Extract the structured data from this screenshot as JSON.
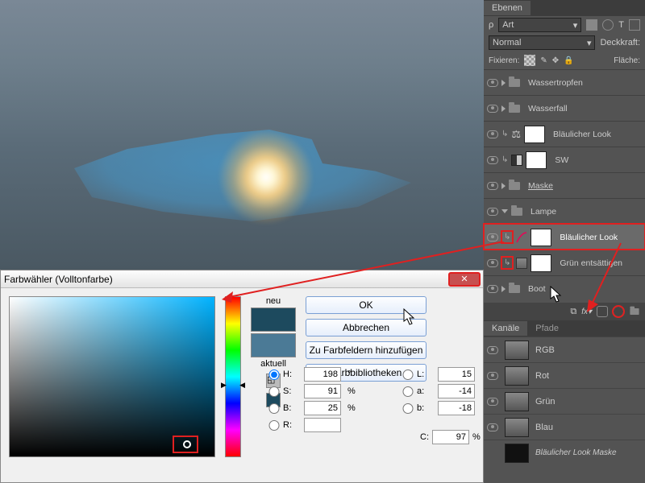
{
  "layersPanel": {
    "tab": "Ebenen",
    "kind": "Art",
    "blend": "Normal",
    "opacityLabel": "Deckkraft:",
    "lockLabel": "Fixieren:",
    "fillLabel": "Fläche:",
    "groups": [
      {
        "name": "Wassertropfen",
        "folder": true
      },
      {
        "name": "Wasserfall",
        "folder": true
      }
    ],
    "adjLayers": [
      {
        "name": "Bläulicher Look",
        "icon": "balance"
      },
      {
        "name": "SW",
        "icon": "bw"
      }
    ],
    "groups2": [
      {
        "name": "Maske",
        "folder": true,
        "underline": true
      },
      {
        "name": "Lampe",
        "folder": true
      }
    ],
    "selected": {
      "name": "Bläulicher Look"
    },
    "below": {
      "name": "Grün entsättigen"
    },
    "bootGroup": {
      "name": "Boot"
    }
  },
  "channelsPanel": {
    "tabs": [
      "Kanäle",
      "Pfade"
    ],
    "channels": [
      "RGB",
      "Rot",
      "Grün",
      "Blau"
    ],
    "mask": "Bläulicher Look Maske"
  },
  "colorPicker": {
    "title": "Farbwähler (Volltonfarbe)",
    "newLabel": "neu",
    "currentLabel": "aktuell",
    "newColor": "#1d4a5e",
    "currentColor": "#4b7a96",
    "buttons": {
      "ok": "OK",
      "cancel": "Abbrechen",
      "add": "Zu Farbfeldern hinzufügen",
      "lib": "Farbbibliotheken"
    },
    "fields": {
      "H": {
        "label": "H:",
        "value": "198",
        "unit": "°"
      },
      "S": {
        "label": "S:",
        "value": "91",
        "unit": "%"
      },
      "Br": {
        "label": "B:",
        "value": "25",
        "unit": "%"
      },
      "R": {
        "label": "R:",
        "value": ""
      },
      "L": {
        "label": "L:",
        "value": "15"
      },
      "a": {
        "label": "a:",
        "value": "-14"
      },
      "b": {
        "label": "b:",
        "value": "-18"
      },
      "C": {
        "label": "C:",
        "value": "97",
        "unit": "%"
      }
    }
  }
}
